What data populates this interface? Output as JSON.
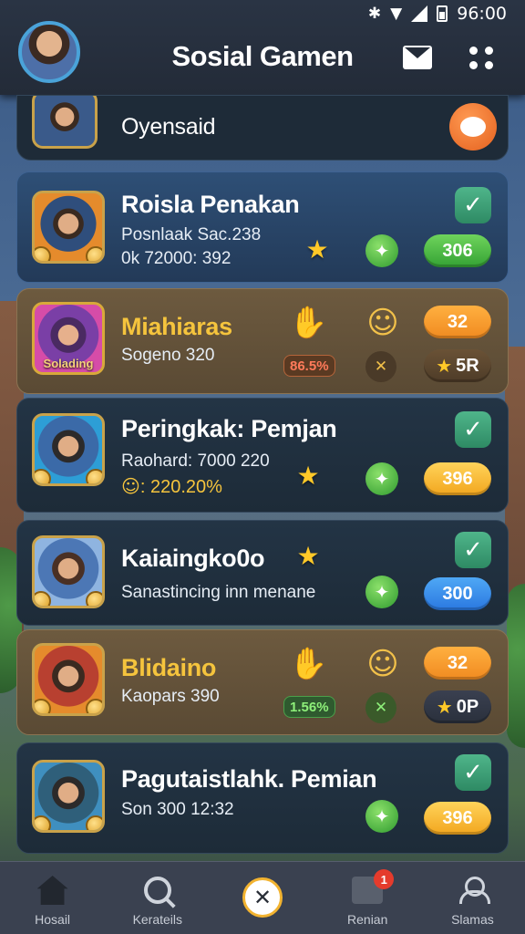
{
  "status_bar": {
    "time": "96:00"
  },
  "header": {
    "title": "Sosial Gamen"
  },
  "top_item": {
    "name": "Oyensaid"
  },
  "items": [
    {
      "name": "Roisla Penakan",
      "line1": "Posnlaak Sac.238",
      "line2": "0k 72000: 392",
      "pill": "306",
      "pill_color": "#3fb23f"
    },
    {
      "name": "Miahiaras",
      "thumb_label": "Solading",
      "line1": "Sogeno 320",
      "pill_top": "32",
      "pill_bottom": "5R",
      "badge": "86.5%"
    },
    {
      "name": "Peringkak: Pemjan",
      "line1": "Raohard: 7000 220",
      "line2": "220.20%",
      "pill": "396"
    },
    {
      "name": "Kaiaingko0o",
      "line1": "Sanastincing inn menane",
      "pill": "300"
    },
    {
      "name": "Blidaino",
      "line1": "Kaopars 390",
      "pill_top": "32",
      "pill_bottom": "0P",
      "badge": "1.56%"
    },
    {
      "name": "Pagutaistlahk. Pemian",
      "line1": "Son 300 12:32",
      "pill": "396"
    }
  ],
  "tabbar": {
    "tabs": [
      "Hosail",
      "Kerateils",
      "",
      "Renian",
      "Slamas"
    ],
    "notification_count": "1"
  }
}
